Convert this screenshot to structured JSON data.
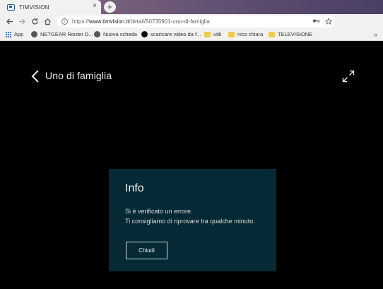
{
  "browser": {
    "tab": {
      "title": "TIMVISION",
      "close": "×"
    },
    "new_tab": "+",
    "address": {
      "scheme": "https://",
      "host": "www.timvision.it",
      "path": "/detail/50735901-uno-di-famiglia"
    },
    "bookmarks": [
      {
        "label": "App",
        "icon": "apps-icon"
      },
      {
        "label": "NETGEAR Router D...",
        "icon": "globe-icon"
      },
      {
        "label": "Nuova scheda",
        "icon": "globe-icon"
      },
      {
        "label": "scaricare video da f...",
        "icon": "pacman-icon"
      },
      {
        "label": "utili",
        "icon": "folder-icon"
      },
      {
        "label": "nico chiara",
        "icon": "folder-icon"
      },
      {
        "label": "TELEVISIONE",
        "icon": "folder-icon"
      }
    ],
    "bookmarks_overflow": "»"
  },
  "player": {
    "title": "Uno di famiglia"
  },
  "modal": {
    "title": "Info",
    "message_line1": "Si è verificato un errore.",
    "message_line2": "Ti consigliamo di riprovare tra qualche minuto.",
    "button_label": "Chiudi"
  },
  "colors": {
    "modal_bg": "#062a35",
    "page_bg": "#000000",
    "folder": "#f2c94c"
  }
}
